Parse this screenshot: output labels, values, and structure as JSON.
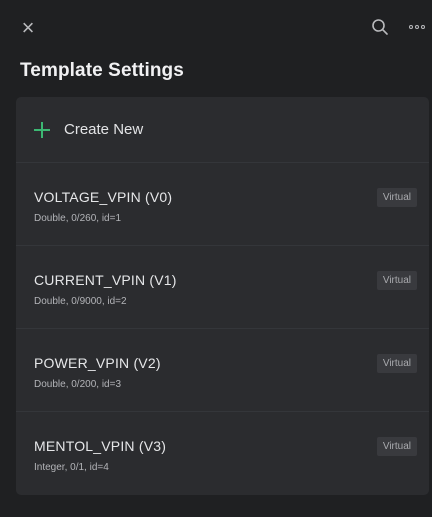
{
  "header": {
    "close_icon": "×",
    "search_icon": "search-icon",
    "more_icon": "more-icon",
    "title": "Template Settings"
  },
  "create": {
    "label": "Create New"
  },
  "pins": [
    {
      "name": "VOLTAGE_VPIN (V0)",
      "meta": "Double, 0/260, id=1",
      "badge": "Virtual"
    },
    {
      "name": "CURRENT_VPIN (V1)",
      "meta": "Double, 0/9000, id=2",
      "badge": "Virtual"
    },
    {
      "name": "POWER_VPIN (V2)",
      "meta": "Double, 0/200, id=3",
      "badge": "Virtual"
    },
    {
      "name": "MENTOL_VPIN (V3)",
      "meta": "Integer, 0/1, id=4",
      "badge": "Virtual"
    }
  ],
  "colors": {
    "background": "#1f2022",
    "panel": "#2b2c2f",
    "accent": "#3cb873"
  }
}
